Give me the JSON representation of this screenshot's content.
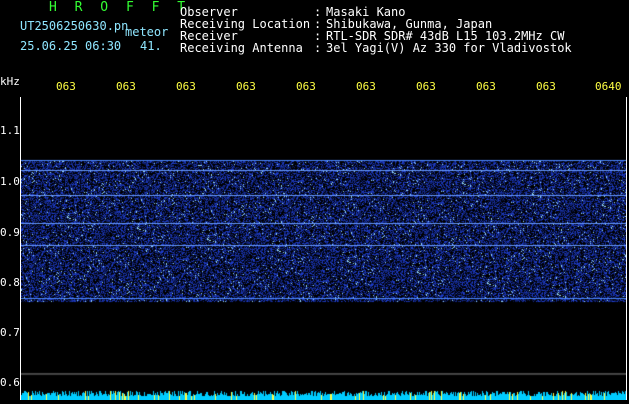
{
  "header": {
    "app_title": "H R O F F T",
    "filename": "UT2506250630.pn",
    "filename_suffix": "meteor",
    "datetime": "25.06.25 06:30",
    "count": "41.",
    "fields": [
      {
        "key": "Observer",
        "value": "Masaki Kano"
      },
      {
        "key": "Receiving Location",
        "value": "Shibukawa, Gunma, Japan"
      },
      {
        "key": "Receiver",
        "value": "RTL-SDR SDR# 43dB L15 103.2MHz CW"
      },
      {
        "key": "Receiving Antenna",
        "value": "3el Yagi(V) Az 330 for Vladivostok"
      }
    ],
    "separator": ":"
  },
  "chart_data": {
    "type": "heatmap",
    "ylabel": "kHz",
    "y_ticks": [
      "1.1",
      "1.0",
      "0.9",
      "0.8",
      "0.7",
      "0.6"
    ],
    "x_ticks": [
      "063",
      "063",
      "063",
      "063",
      "063",
      "063",
      "063",
      "063",
      "063",
      "0640"
    ],
    "noise_band_khz": [
      0.76,
      1.04
    ],
    "carrier_lines_khz": [
      1.04,
      1.02,
      0.97,
      0.915,
      0.87,
      0.765
    ],
    "colors": {
      "background": "#000000",
      "signal": "#3366ff",
      "bright": "#99ddff",
      "bottom_strip": "#00ccff"
    }
  }
}
